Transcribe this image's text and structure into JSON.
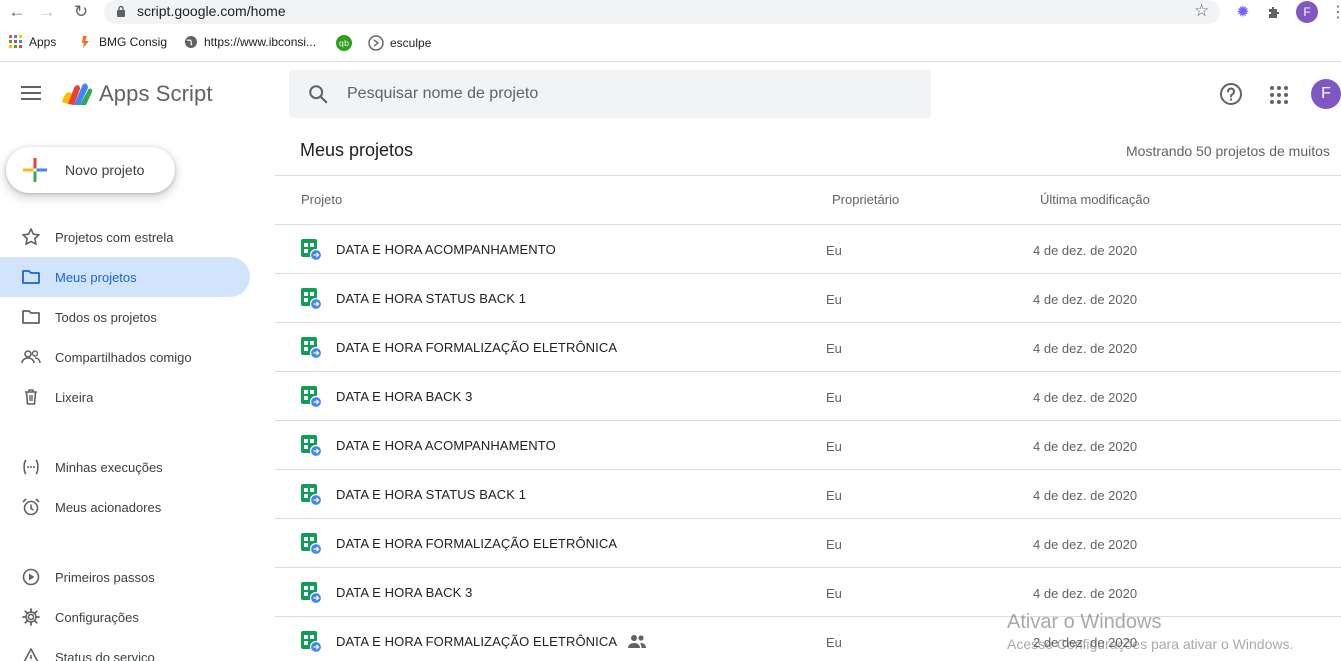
{
  "browser": {
    "url": "script.google.com/home",
    "avatar_letter": "F",
    "bookmarks": [
      {
        "label": "Apps",
        "icon": "apps-grid-icon"
      },
      {
        "label": "BMG Consig",
        "icon": "bmg-icon"
      },
      {
        "label": "https://www.ibconsi...",
        "icon": "globe-icon"
      },
      {
        "label": "",
        "icon": "qb-icon"
      },
      {
        "label": "esculpe",
        "icon": "esculpe-icon"
      }
    ]
  },
  "app": {
    "title": "Apps Script",
    "search_placeholder": "Pesquisar nome de projeto",
    "avatar_letter": "F"
  },
  "sidebar": {
    "new_project_label": "Novo projeto",
    "items": [
      {
        "label": "Projetos com estrela",
        "icon": "star-icon"
      },
      {
        "label": "Meus projetos",
        "icon": "folder-icon",
        "active": true
      },
      {
        "label": "Todos os projetos",
        "icon": "folder-icon"
      },
      {
        "label": "Compartilhados comigo",
        "icon": "people-icon"
      },
      {
        "label": "Lixeira",
        "icon": "trash-icon"
      },
      {
        "label": "Minhas execuções",
        "icon": "executions-icon"
      },
      {
        "label": "Meus acionadores",
        "icon": "alarm-icon"
      },
      {
        "label": "Primeiros passos",
        "icon": "play-circle-icon"
      },
      {
        "label": "Configurações",
        "icon": "gear-icon"
      },
      {
        "label": "Status do serviço",
        "icon": "warning-icon"
      }
    ]
  },
  "main": {
    "title": "Meus projetos",
    "count": "Mostrando 50 projetos de muitos",
    "columns": [
      "Projeto",
      "Proprietário",
      "Última modificação"
    ],
    "rows": [
      {
        "name": "DATA E HORA ACOMPANHAMENTO",
        "owner": "Eu",
        "date": "4 de dez. de 2020",
        "shared": false
      },
      {
        "name": "DATA E HORA STATUS BACK 1",
        "owner": "Eu",
        "date": "4 de dez. de 2020",
        "shared": false
      },
      {
        "name": "DATA E HORA FORMALIZAÇÃO ELETRÔNICA",
        "owner": "Eu",
        "date": "4 de dez. de 2020",
        "shared": false
      },
      {
        "name": "DATA E HORA BACK 3",
        "owner": "Eu",
        "date": "4 de dez. de 2020",
        "shared": false
      },
      {
        "name": "DATA E HORA ACOMPANHAMENTO",
        "owner": "Eu",
        "date": "4 de dez. de 2020",
        "shared": false
      },
      {
        "name": "DATA E HORA STATUS BACK 1",
        "owner": "Eu",
        "date": "4 de dez. de 2020",
        "shared": false
      },
      {
        "name": "DATA E HORA FORMALIZAÇÃO ELETRÔNICA",
        "owner": "Eu",
        "date": "4 de dez. de 2020",
        "shared": false
      },
      {
        "name": "DATA E HORA BACK 3",
        "owner": "Eu",
        "date": "4 de dez. de 2020",
        "shared": false
      },
      {
        "name": "DATA E HORA FORMALIZAÇÃO ELETRÔNICA",
        "owner": "Eu",
        "date": "2 de dez. de 2020",
        "shared": true
      }
    ]
  },
  "watermark": {
    "line1": "Ativar o Windows",
    "line2": "Acesse Configurações para ativar o Windows."
  }
}
